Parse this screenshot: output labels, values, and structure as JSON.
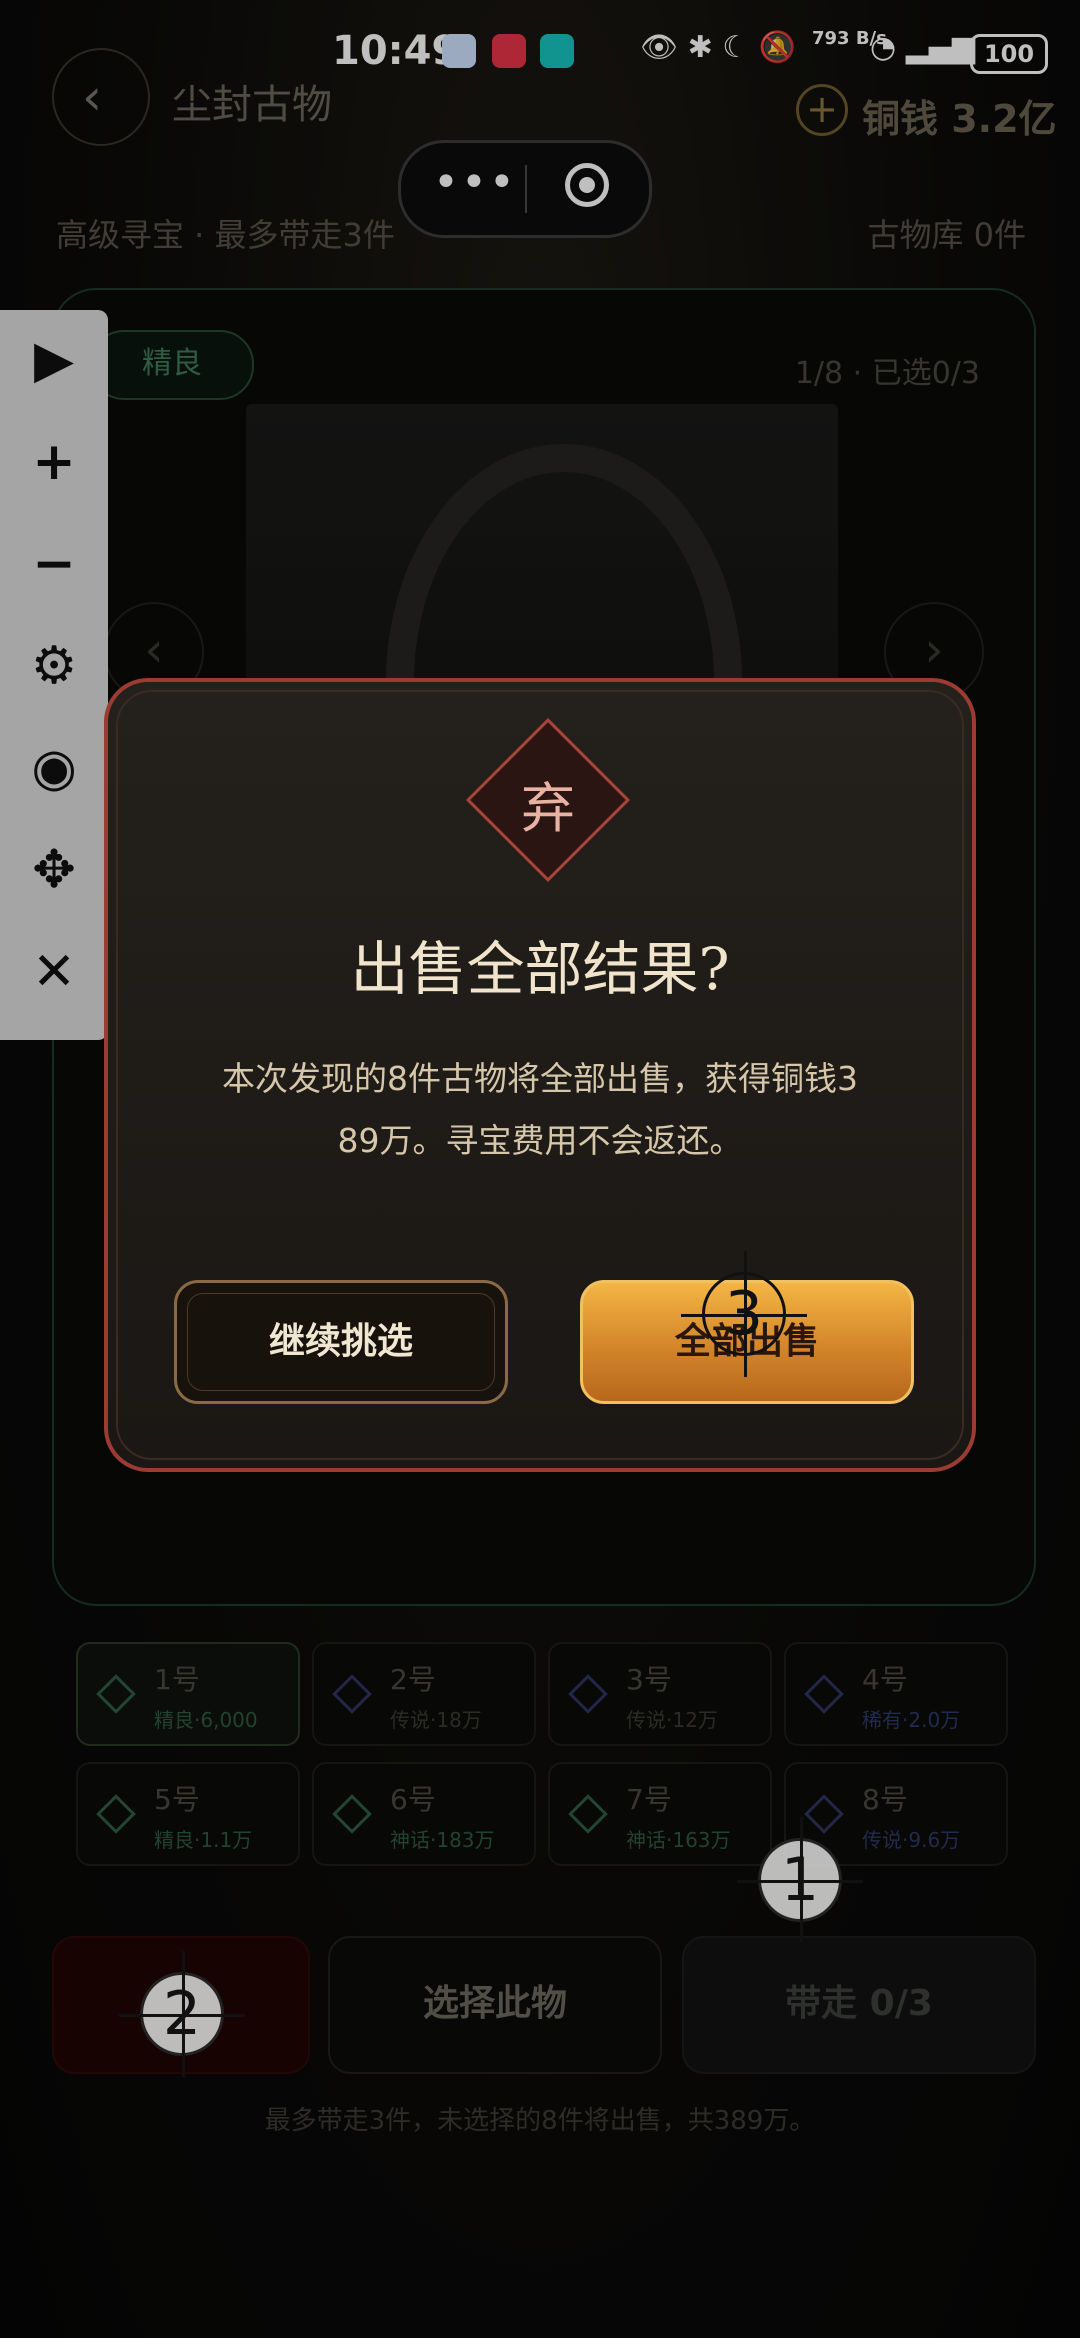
{
  "status_bar": {
    "time": "10:49",
    "net_speed": "793 B/s",
    "battery": "100"
  },
  "header": {
    "title": "尘封古物",
    "coins": "铜钱 3.2亿"
  },
  "subheader": {
    "mode": "高级寻宝 · 最多带走3件",
    "library": "古物库 0件"
  },
  "card": {
    "grade_tag": "精良",
    "pager": "1/8 · 已选0/3"
  },
  "slots": [
    {
      "num": "1号",
      "sub": "精良·6,000"
    },
    {
      "num": "2号",
      "sub": "传说·18万"
    },
    {
      "num": "3号",
      "sub": "传说·12万"
    },
    {
      "num": "4号",
      "sub": "稀有·2.0万"
    },
    {
      "num": "5号",
      "sub": "精良·1.1万"
    },
    {
      "num": "6号",
      "sub": "神话·183万"
    },
    {
      "num": "7号",
      "sub": "神话·163万"
    },
    {
      "num": "8号",
      "sub": "传说·9.6万"
    }
  ],
  "actions": {
    "select": "选择此物",
    "take": "带走 0/3"
  },
  "hint": "最多带走3件，未选择的8件将出售，共389万。",
  "toolbar": {
    "icons": [
      "play-icon",
      "zoom-in-icon",
      "zoom-out-icon",
      "gear-icon",
      "eye-off-icon",
      "move-icon",
      "close-icon"
    ]
  },
  "modal": {
    "badge": "弃",
    "title": "出售全部结果?",
    "body_line1": "本次发现的8件古物将全部出售，获得铜钱3",
    "body_line2": "89万。寻宝费用不会返还。",
    "continue_label": "继续挑选",
    "sell_label": "全部出售"
  },
  "markers": {
    "m1": "1",
    "m2": "2",
    "m3": "3"
  }
}
